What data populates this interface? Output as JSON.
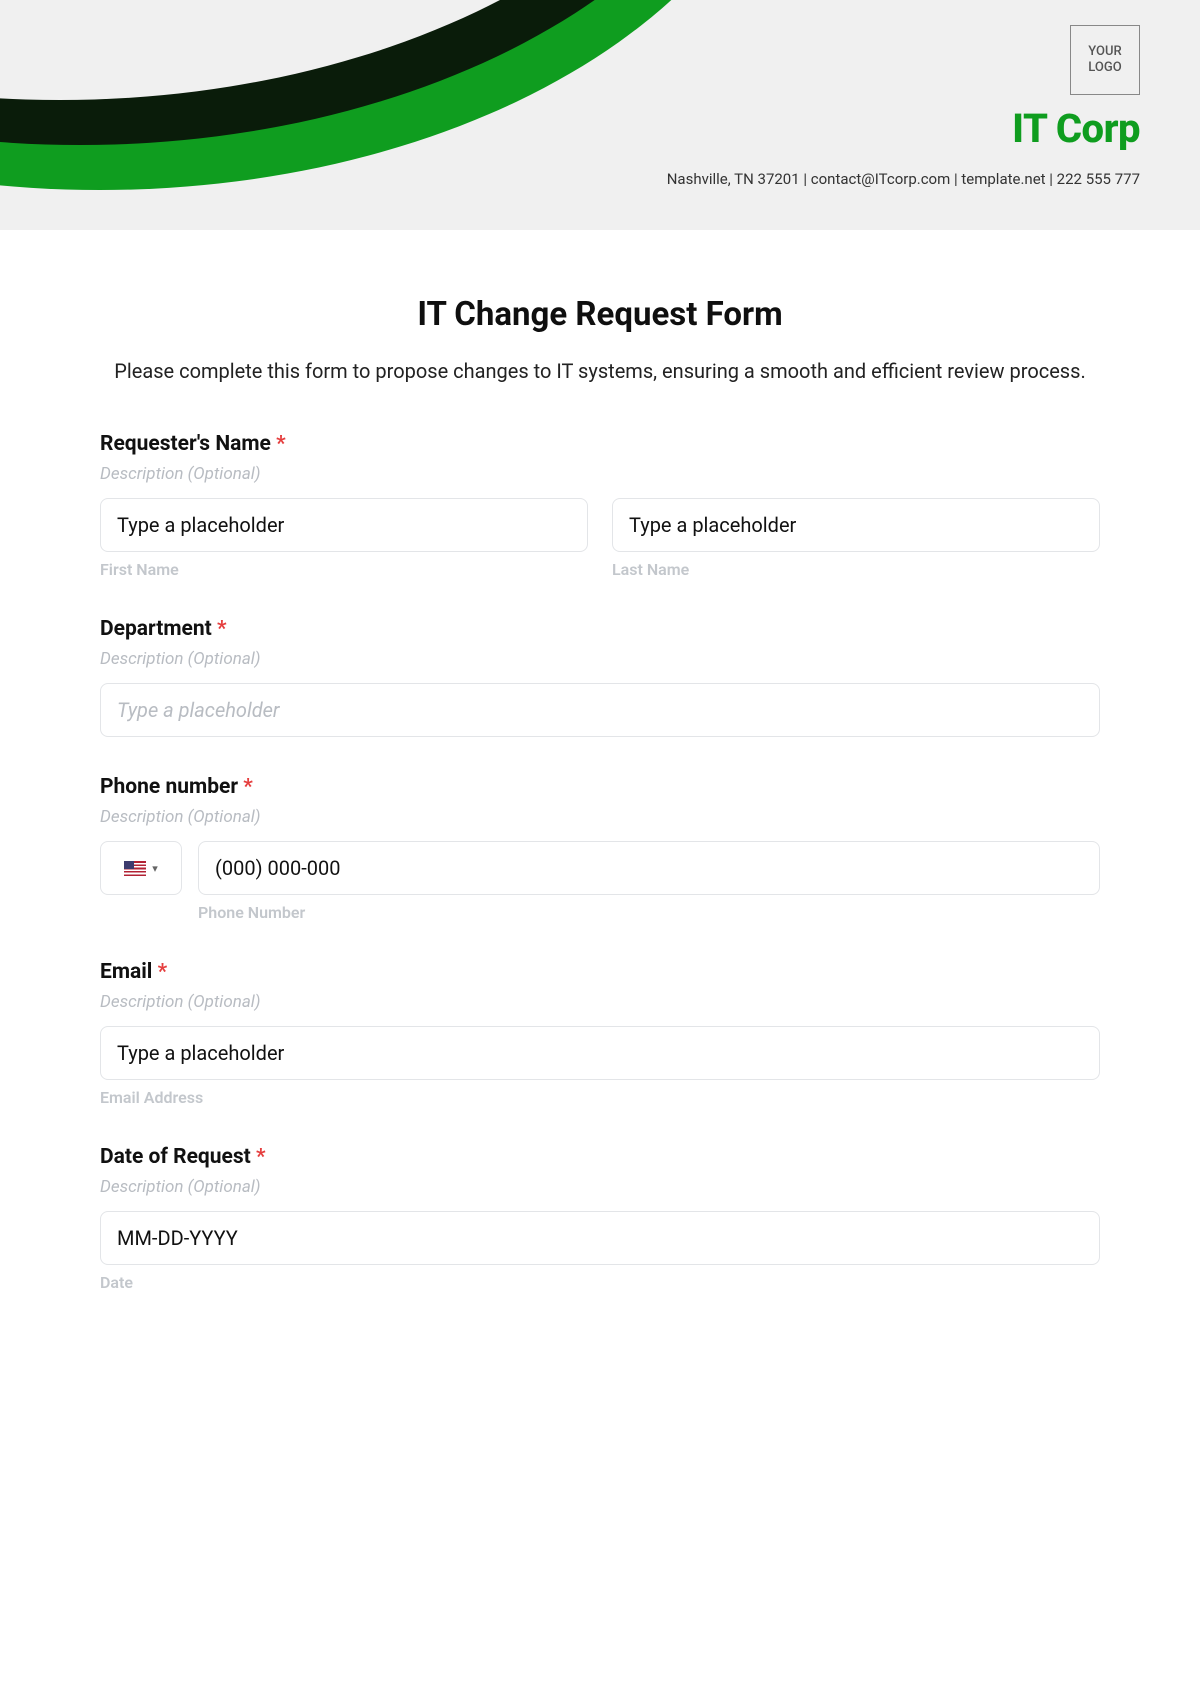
{
  "header": {
    "logo_text": "YOUR\nLOGO",
    "company_name": "IT Corp",
    "contact_line": "Nashville, TN 37201 | contact@ITcorp.com | template.net | 222 555 777"
  },
  "form": {
    "title": "IT Change Request Form",
    "intro": "Please complete this form to propose changes to IT systems, ensuring a smooth and efficient review process.",
    "required_marker": "*",
    "desc_placeholder": "Description (Optional)",
    "fields": {
      "requester": {
        "label": "Requester's Name",
        "first_value": "Type a placeholder",
        "last_value": "Type a placeholder",
        "first_sub": "First Name",
        "last_sub": "Last Name"
      },
      "department": {
        "label": "Department",
        "placeholder": "Type a placeholder"
      },
      "phone": {
        "label": "Phone number",
        "placeholder": "(000) 000-000",
        "sub": "Phone Number",
        "country_icon": "us-flag"
      },
      "email": {
        "label": "Email",
        "value": "Type a placeholder",
        "sub": "Email Address"
      },
      "date": {
        "label": "Date of Request",
        "value": "MM-DD-YYYY",
        "sub": "Date"
      }
    }
  }
}
